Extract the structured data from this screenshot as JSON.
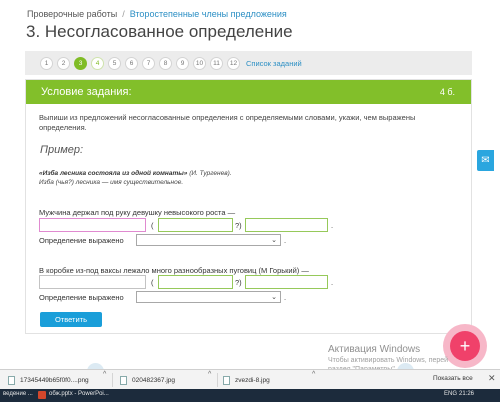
{
  "breadcrumb": {
    "parent": "Проверочные работы",
    "separator": "/",
    "current": "Второстепенные члены предложения"
  },
  "page_title": "3. Несогласованное определение",
  "task_nav": {
    "numbers": [
      "1",
      "2",
      "3",
      "4",
      "5",
      "6",
      "7",
      "8",
      "9",
      "10",
      "11",
      "12"
    ],
    "active": "3",
    "list_link": "Список заданий"
  },
  "task": {
    "header_title": "Условие задания:",
    "points": "4 б.",
    "instruction": "Выпиши из предложений несогласованные определения с определяемыми словами, укажи, чем выражены определения.",
    "example_heading": "Пример:",
    "example_quote": "«Изба лесника состояла из одной комнаты»",
    "example_author": " (И. Тургенев).",
    "example_explanation": "Изба (чья?) лесника — имя существительное.",
    "sentence1": "Мужчина держал под руку девушку невысокого роста —",
    "sentence2": "В коробке из-под ваксы лежало много разнообразных пуговиц (М Горький) —",
    "open_paren": "(",
    "close_paren_q": "?)",
    "period": ".",
    "expressed_label": "Определение выражено",
    "select_arrow": "⌄",
    "submit_label": "Ответить"
  },
  "floating": {
    "mail_icon": "✉",
    "badge_icon": "+"
  },
  "watermark": {
    "title": "Активация Windows",
    "line1": "Чтобы активировать Windows, перей",
    "line2": "раздел \"Параметры\"."
  },
  "download_bar": {
    "items": [
      "17345449b65f0f0....png",
      "020482367.jpg",
      "zvezdi-8.jpg"
    ],
    "chevron": "^",
    "show_all": "Показать все",
    "close": "✕"
  },
  "taskbar": {
    "left_item": "ведение ...",
    "pp_item": "обж.pptx - PowerPoi...",
    "lang": "ENG",
    "time": "21:26"
  }
}
